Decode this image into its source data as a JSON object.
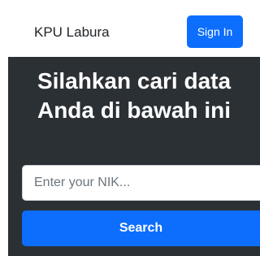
{
  "navbar": {
    "brand": "KPU Labura",
    "signin_label": "Sign In"
  },
  "hero": {
    "title_line1": "Silahkan cari data",
    "title_line2": "Anda di bawah ini"
  },
  "search": {
    "placeholder": "Enter your NIK...",
    "value": "",
    "button_label": "Search"
  },
  "colors": {
    "primary": "#0d6efd",
    "hero_background": "#2b3035"
  }
}
